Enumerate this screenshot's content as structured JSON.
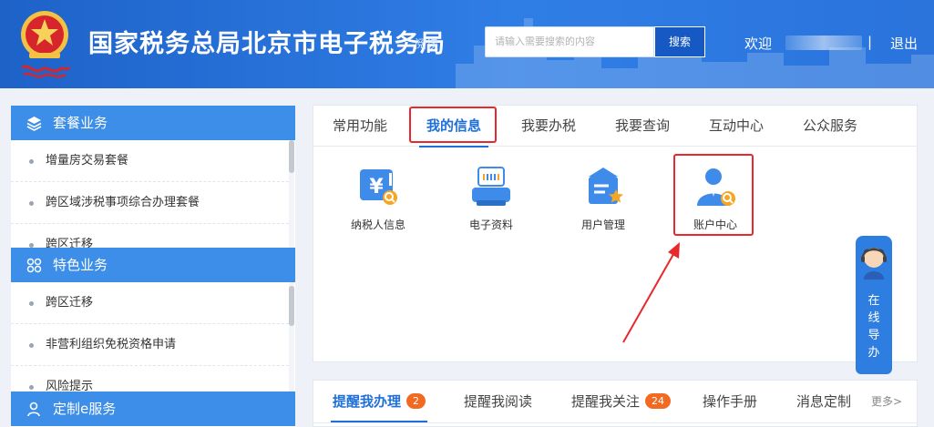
{
  "header": {
    "title": "国家税务总局北京市电子税务局",
    "read_link": "阅读",
    "search_placeholder": "请输入需要搜索的内容",
    "search_button": "搜索",
    "welcome": "欢迎",
    "separator": "|",
    "logout": "退出",
    "brand_color": "#2a74dc"
  },
  "sidebar": {
    "sections": [
      {
        "title": "套餐业务",
        "icon": "layers-icon",
        "items": [
          "增量房交易套餐",
          "跨区域涉税事项综合办理套餐",
          "跨区迁移"
        ]
      },
      {
        "title": "特色业务",
        "icon": "grid-icon",
        "items": [
          "跨区迁移",
          "非营利组织免税资格申请",
          "风险提示"
        ]
      },
      {
        "title": "定制e服务",
        "icon": "person-icon",
        "items": []
      }
    ]
  },
  "main": {
    "tabs": [
      "常用功能",
      "我的信息",
      "我要办税",
      "我要查询",
      "互动中心",
      "公众服务"
    ],
    "active_tab": "我的信息",
    "tiles": [
      {
        "label": "纳税人信息",
        "icon": "taxpayer-info-icon"
      },
      {
        "label": "电子资料",
        "icon": "e-document-icon"
      },
      {
        "label": "用户管理",
        "icon": "user-management-icon"
      },
      {
        "label": "账户中心",
        "icon": "account-center-icon"
      }
    ],
    "highlight_color": "#e8282d"
  },
  "guide": {
    "chars": [
      "在",
      "线",
      "导",
      "办"
    ]
  },
  "bottom": {
    "tabs": [
      {
        "label": "提醒我办理",
        "badge": "2"
      },
      {
        "label": "提醒我阅读",
        "badge": ""
      },
      {
        "label": "提醒我关注",
        "badge": "24"
      },
      {
        "label": "操作手册",
        "badge": ""
      },
      {
        "label": "消息定制",
        "badge": ""
      }
    ],
    "more": "更多>"
  }
}
